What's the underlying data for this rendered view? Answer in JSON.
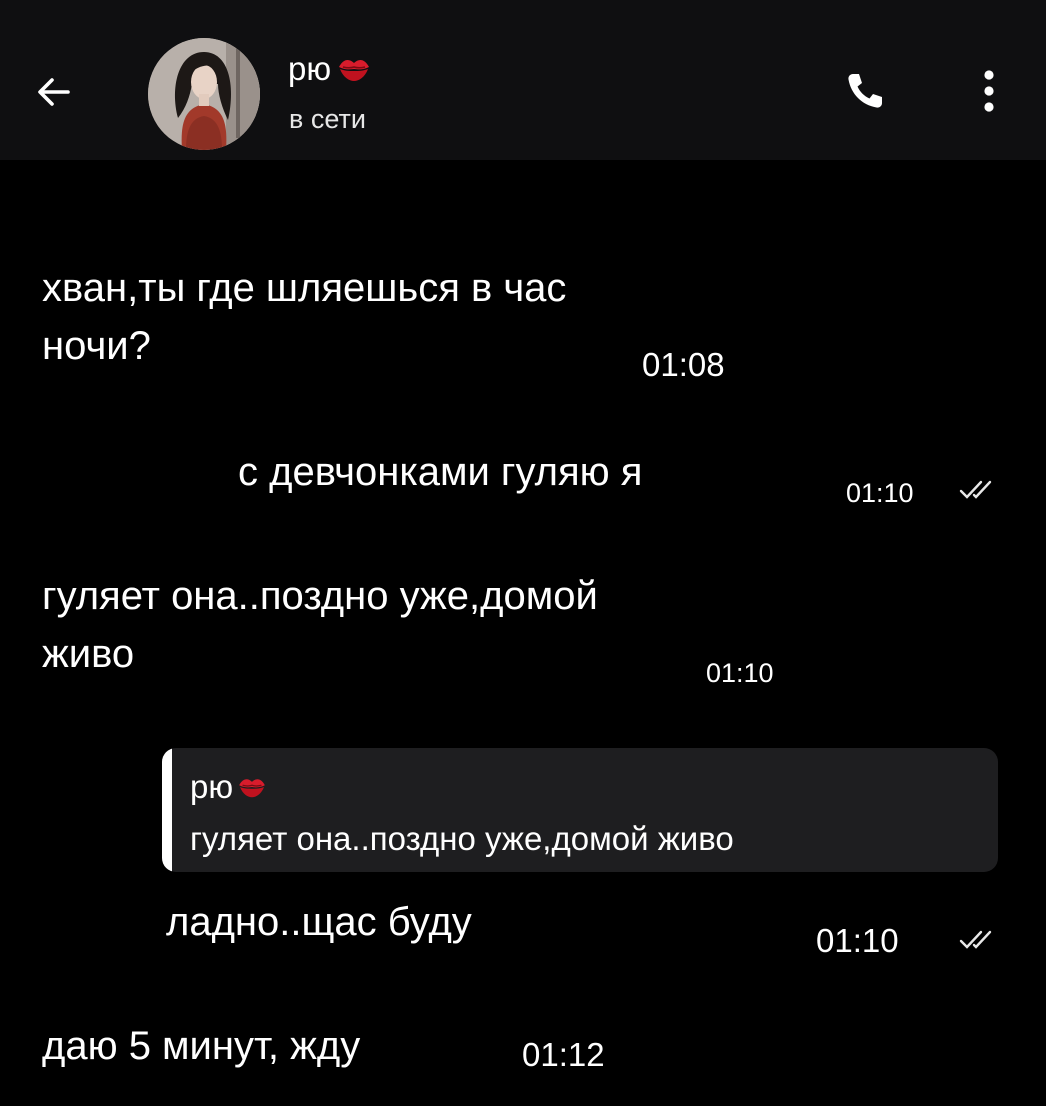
{
  "header": {
    "contact_name": "рю",
    "contact_status": "в сети",
    "back_icon": "arrow-left-icon",
    "call_icon": "phone-icon",
    "menu_icon": "more-vertical-icon",
    "name_emoji": "kiss-mark-icon"
  },
  "messages": [
    {
      "direction": "incoming",
      "lines": [
        "хван,ты где шляешься в час",
        "ночи?"
      ],
      "time": "01:08"
    },
    {
      "direction": "outgoing",
      "lines": [
        "с девчонками гуляю я"
      ],
      "time": "01:10",
      "status": "read"
    },
    {
      "direction": "incoming",
      "lines": [
        "гуляет она..поздно уже,домой",
        "живо"
      ],
      "time": "01:10"
    },
    {
      "direction": "outgoing",
      "reply": {
        "author": "рю",
        "text": "гуляет она..поздно уже,домой живо"
      },
      "lines": [
        "ладно..щас буду"
      ],
      "time": "01:10",
      "status": "read"
    },
    {
      "direction": "incoming",
      "lines": [
        "даю 5 минут, жду"
      ],
      "time": "01:12"
    }
  ],
  "colors": {
    "background": "#000000",
    "header": "#0f0f11",
    "reply_box": "#1e1e20",
    "text": "#ffffff",
    "emoji_red": "#d81c2c"
  }
}
